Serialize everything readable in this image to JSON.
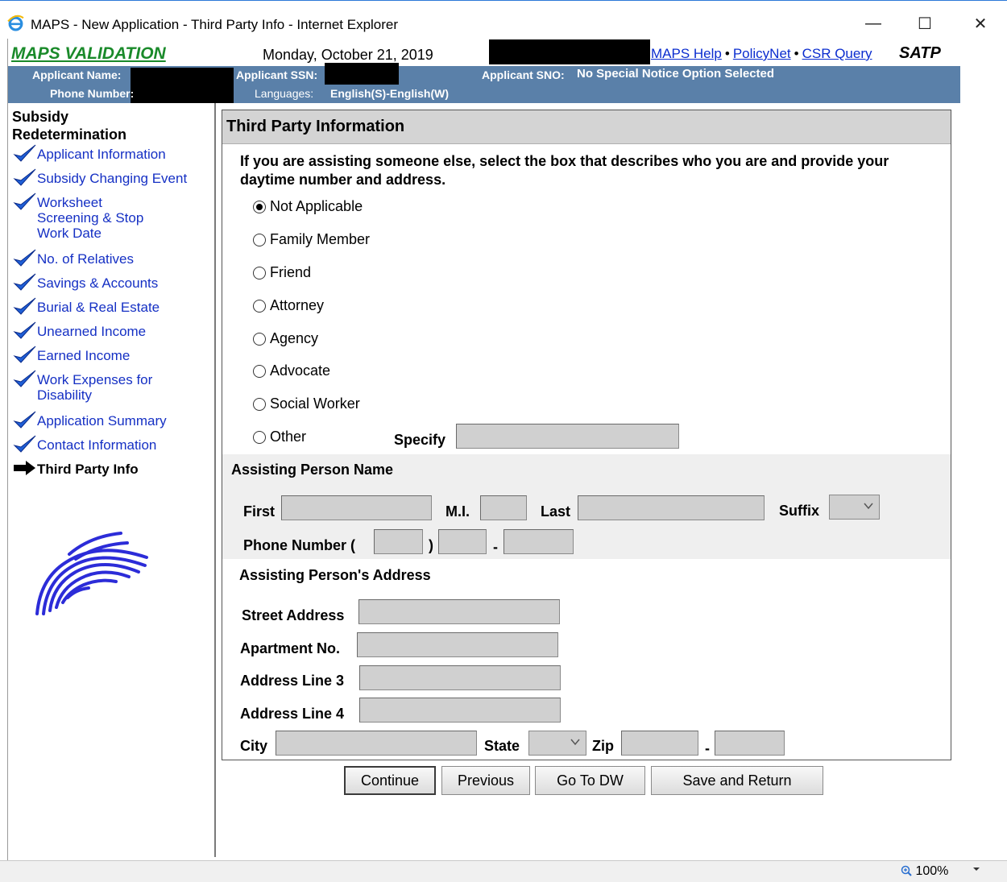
{
  "window": {
    "title": "MAPS - New Application - Third Party Info - Internet Explorer",
    "minimize": "—",
    "maximize": "☐",
    "close": "✕"
  },
  "header": {
    "brand": "MAPS VALIDATION",
    "date": "Monday, October 21, 2019",
    "links": [
      "MAPS Help",
      "PolicyNet",
      "CSR Query"
    ],
    "separator": "•",
    "system": "SATP"
  },
  "applicant": {
    "name_label": "Applicant Name:",
    "phone_label": "Phone Number:",
    "ssn_label": "Applicant SSN:",
    "languages_label": "Languages:",
    "languages_value": "English(S)-English(W)",
    "sno_label": "Applicant SNO:",
    "sno_value": "No Special Notice Option Selected"
  },
  "nav": {
    "title": "Subsidy Redetermination",
    "items": [
      {
        "label": "Applicant Information"
      },
      {
        "label": "Subsidy Changing Event"
      },
      {
        "label": "Worksheet Screening  & Stop Work  Date"
      },
      {
        "label": "No. of Relatives"
      },
      {
        "label": "Savings & Accounts"
      },
      {
        "label": "Burial & Real Estate"
      },
      {
        "label": "Unearned Income"
      },
      {
        "label": "Earned Income"
      },
      {
        "label": "Work Expenses for Disability"
      },
      {
        "label": "Application Summary"
      },
      {
        "label": "Contact Information"
      },
      {
        "label": "Third Party Info"
      }
    ]
  },
  "panel": {
    "title": "Third Party Information",
    "instructions": "If you are assisting someone else, select the box that describes who you are and provide your daytime number and address.",
    "options": [
      "Not Applicable",
      "Family Member",
      "Friend",
      "Attorney",
      "Agency",
      "Advocate",
      "Social Worker",
      "Other"
    ],
    "selected": "Not Applicable",
    "specify_label": "Specify",
    "name_section": "Assisting Person Name",
    "first_label": "First",
    "mi_label": "M.I.",
    "last_label": "Last",
    "suffix_label": "Suffix",
    "phone_label": "Phone Number (",
    "phone_close": ")",
    "phone_dash": "-",
    "address_section": "Assisting Person's Address",
    "street_label": "Street Address",
    "apt_label": "Apartment No.",
    "line3_label": "Address Line 3",
    "line4_label": "Address Line 4",
    "city_label": "City",
    "state_label": "State",
    "zip_label": "Zip",
    "zip_dash": "-"
  },
  "buttons": {
    "continue": "Continue",
    "previous": "Previous",
    "goto": "Go To DW",
    "save": "Save and Return"
  },
  "status": {
    "zoom": "100%"
  },
  "colors": {
    "brand_green": "#1a8a2a",
    "header_blue": "#5a80a9",
    "link_blue": "#1530c4"
  }
}
